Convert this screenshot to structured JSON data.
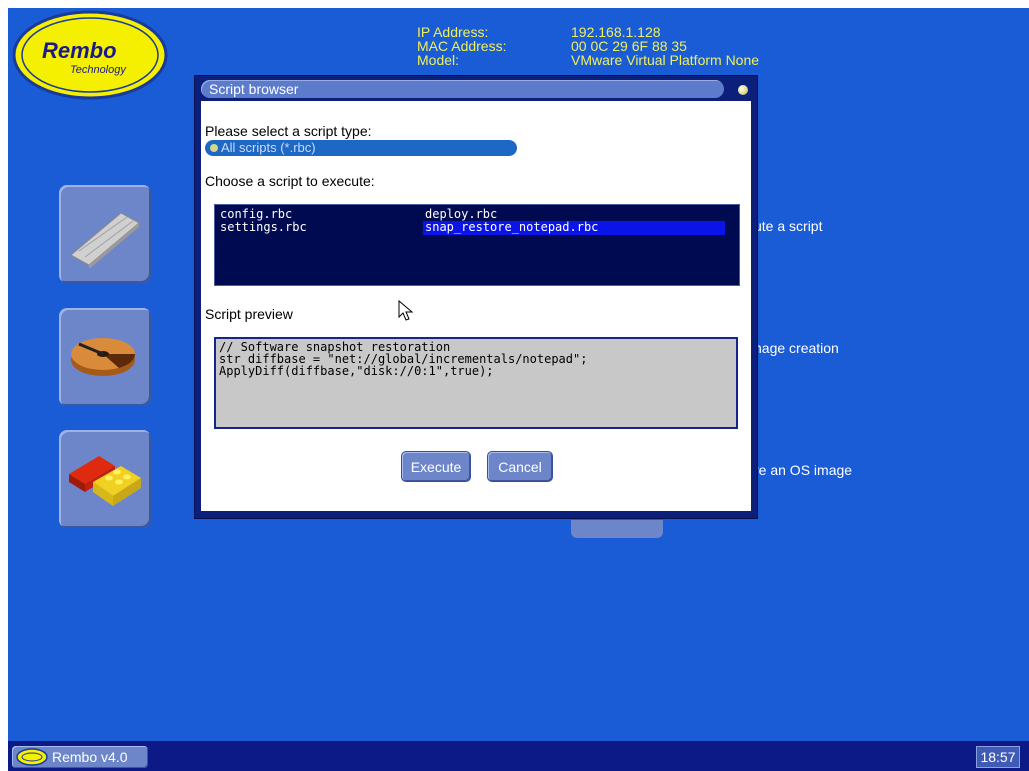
{
  "brand": {
    "logo_text": "Rembo",
    "logo_subtext": "Technology",
    "colors": {
      "desktop": "#1a5bd6",
      "logo_yellow": "#f5f000",
      "info_text": "#f0f05a"
    }
  },
  "machine_info": {
    "labels": [
      "IP Address:",
      "MAC Address:",
      "Model:"
    ],
    "values": [
      "192.168.1.128",
      "00 0C 29 6F 88 35",
      "VMware Virtual Platform None"
    ]
  },
  "side_buttons": [
    {
      "icon": "keyboard-icon",
      "label_partial": "ute a script"
    },
    {
      "icon": "disk-image-icon",
      "label_partial": "nage creation"
    },
    {
      "icon": "lego-bricks-icon",
      "label_partial": "re an OS image"
    }
  ],
  "dialog": {
    "title": "Script browser",
    "type_prompt": "Please select a script type:",
    "type_selected": "All scripts (*.rbc)",
    "choose_prompt": "Choose a script to execute:",
    "scripts": [
      "config.rbc",
      "settings.rbc",
      "deploy.rbc",
      "snap_restore_notepad.rbc"
    ],
    "selected_script": "snap_restore_notepad.rbc",
    "preview_label": "Script preview",
    "preview_lines": [
      "// Software snapshot restoration",
      "str diffbase = \"net://global/incrementals/notepad\";",
      "ApplyDiff(diffbase,\"disk://0:1\",true);"
    ],
    "execute_label": "Execute",
    "cancel_label": "Cancel"
  },
  "taskbar": {
    "start_label": "Rembo v4.0",
    "clock": "18:57"
  }
}
